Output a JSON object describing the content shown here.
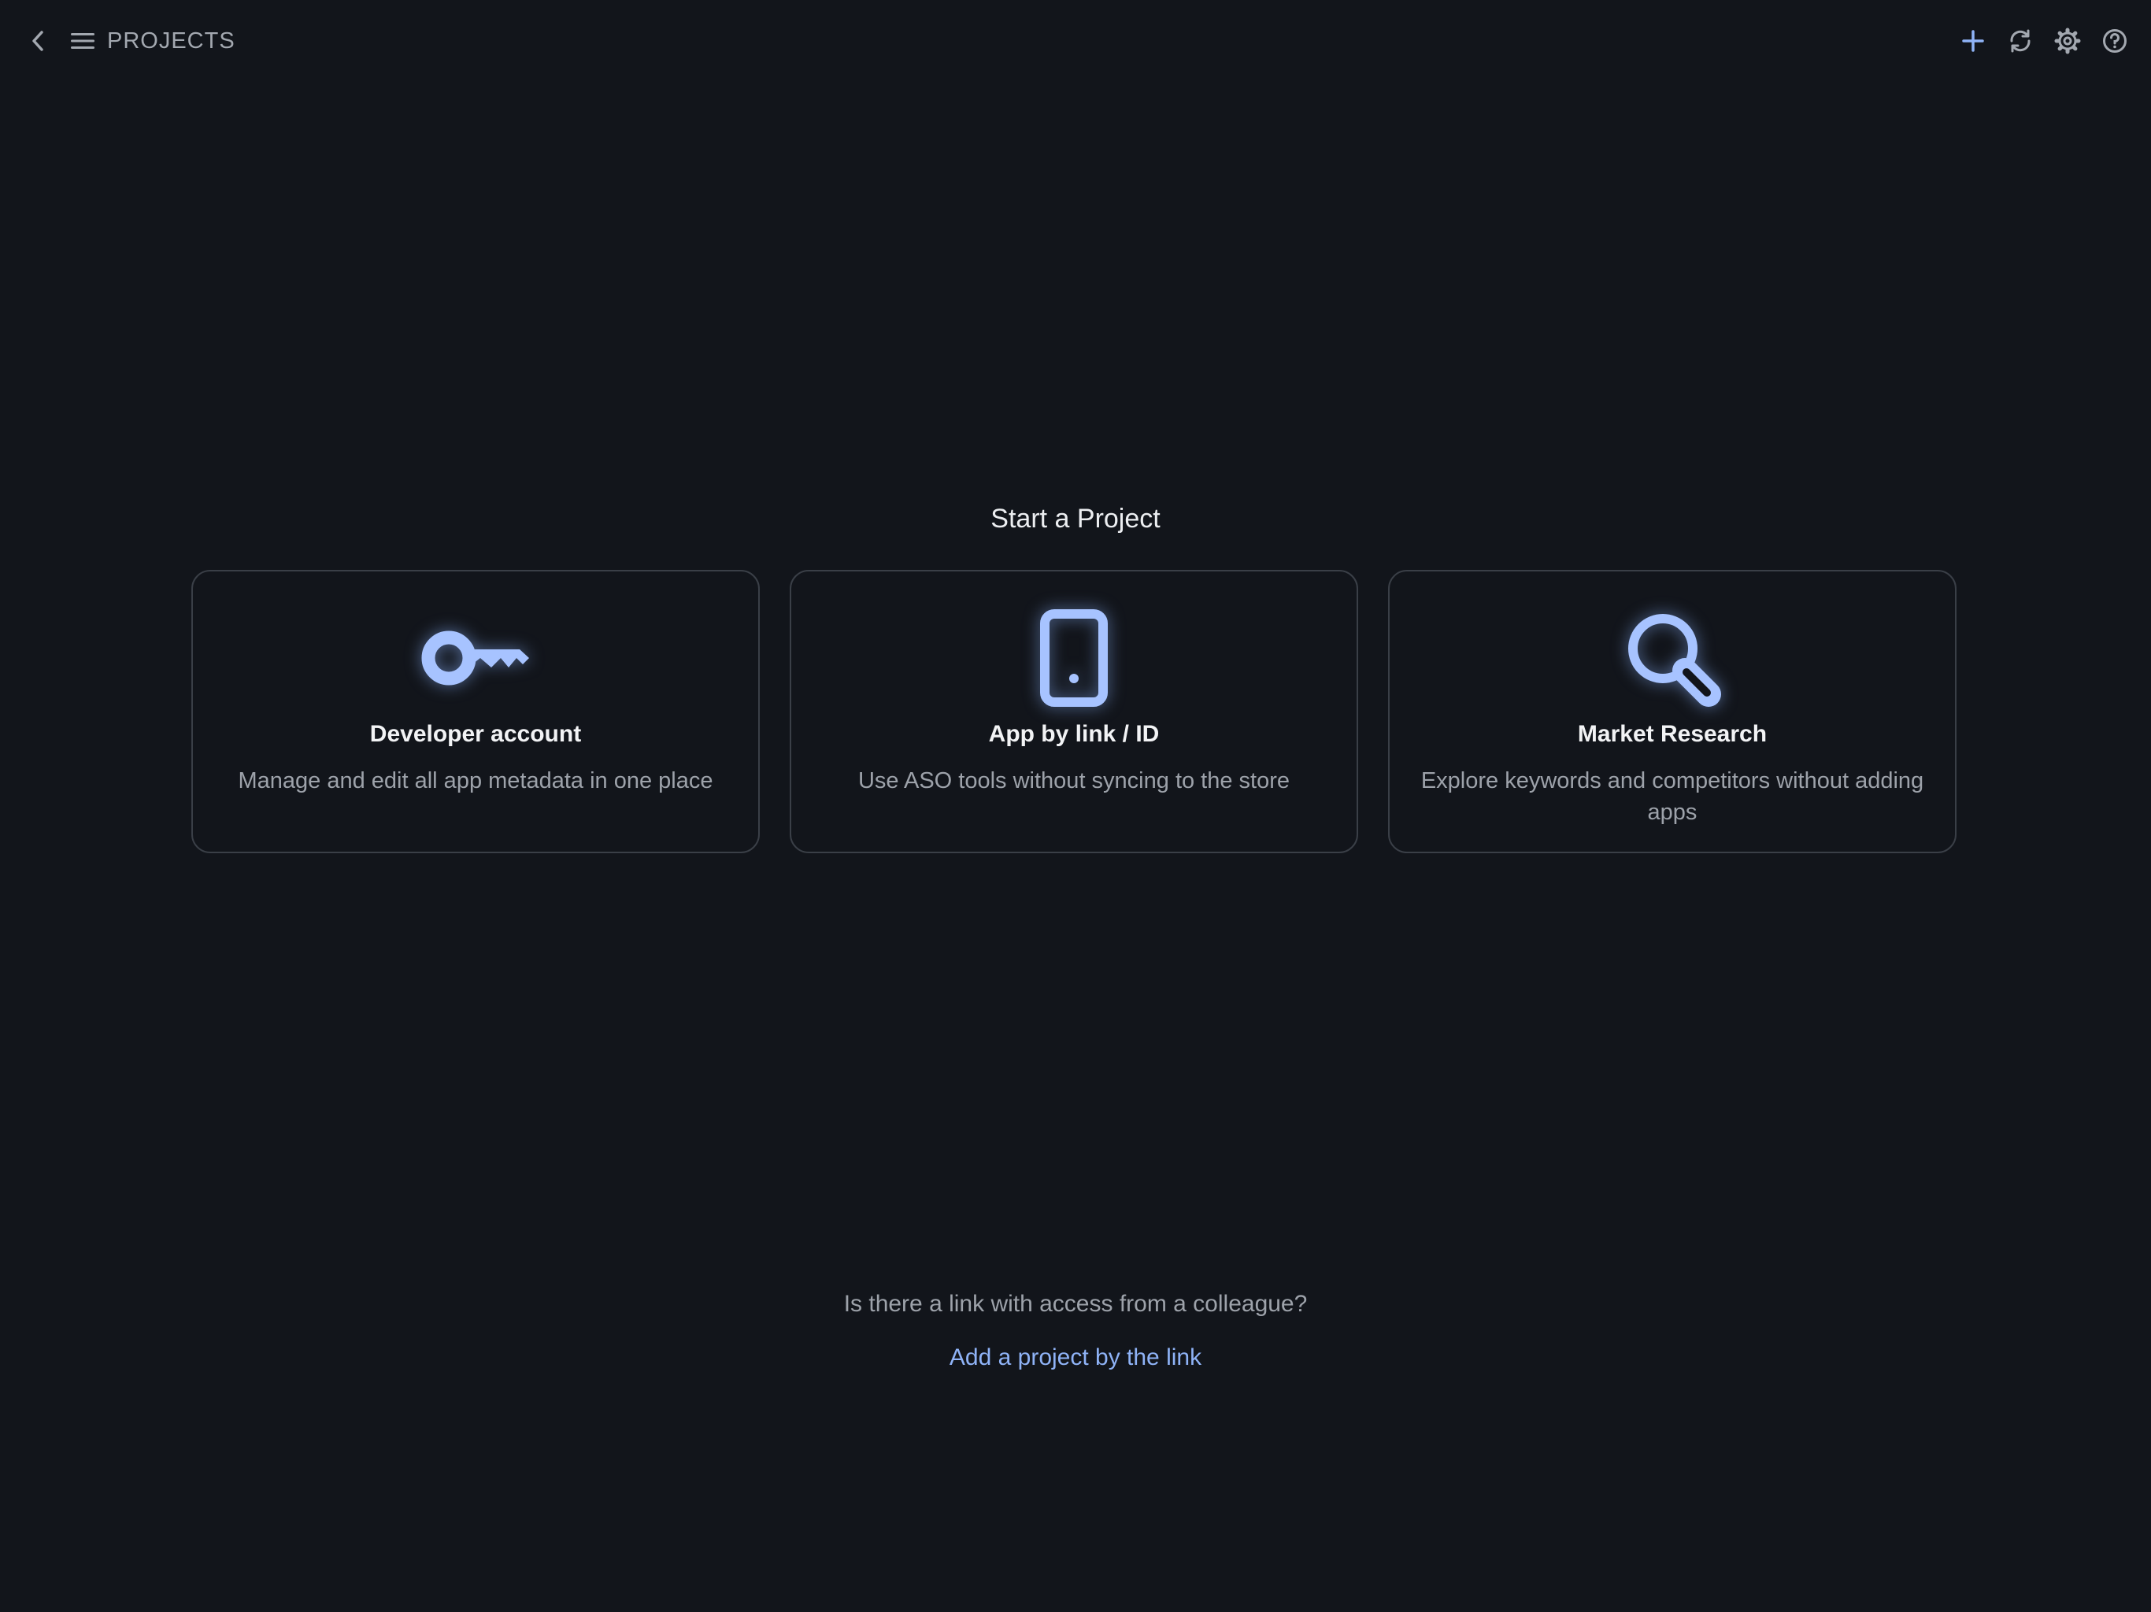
{
  "topbar": {
    "title": "PROJECTS",
    "icons": {
      "back": "chevron-left-icon",
      "menu": "hamburger-icon",
      "add": "plus-icon",
      "sync": "refresh-icon",
      "settings": "gear-icon",
      "help": "help-circle-icon"
    }
  },
  "main": {
    "heading": "Start a Project",
    "cards": [
      {
        "icon": "key-icon",
        "title": "Developer account",
        "description": "Manage and edit all app metadata in one place"
      },
      {
        "icon": "phone-icon",
        "title": "App by link / ID",
        "description": "Use ASO tools without syncing to the store"
      },
      {
        "icon": "magnifier-icon",
        "title": "Market Research",
        "description": "Explore keywords and competitors without adding apps"
      }
    ]
  },
  "footer": {
    "question": "Is there a link with access from a colleague?",
    "link_label": "Add a project by the link"
  },
  "colors": {
    "background": "#12151b",
    "accent": "#8fb3f7",
    "icon": "#a7c3ff",
    "card_border": "#3a3f47",
    "muted_text": "#9da2aa"
  }
}
